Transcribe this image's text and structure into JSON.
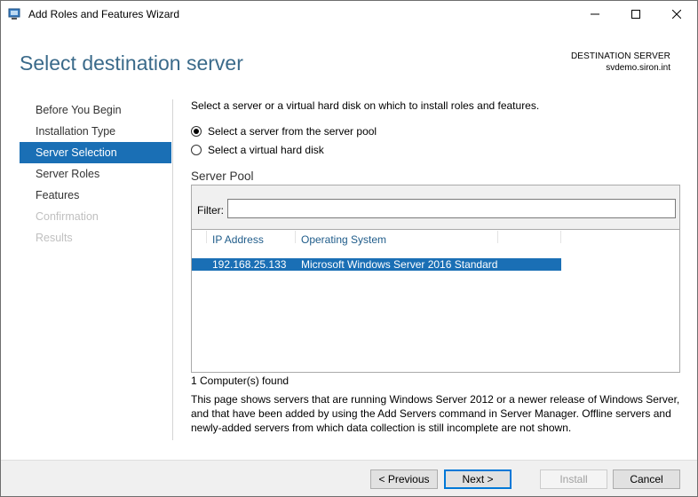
{
  "window": {
    "title": "Add Roles and Features Wizard"
  },
  "header": {
    "title": "Select destination server",
    "destination_label": "DESTINATION SERVER",
    "destination_value": "svdemo.siron.int"
  },
  "nav": {
    "items": [
      {
        "label": "Before You Begin",
        "state": "normal"
      },
      {
        "label": "Installation Type",
        "state": "normal"
      },
      {
        "label": "Server Selection",
        "state": "active"
      },
      {
        "label": "Server Roles",
        "state": "normal"
      },
      {
        "label": "Features",
        "state": "normal"
      },
      {
        "label": "Confirmation",
        "state": "disabled"
      },
      {
        "label": "Results",
        "state": "disabled"
      }
    ]
  },
  "main": {
    "instruction": "Select a server or a virtual hard disk on which to install roles and features.",
    "options": [
      {
        "label": "Select a server from the server pool",
        "selected": true
      },
      {
        "label": "Select a virtual hard disk",
        "selected": false
      }
    ],
    "pool": {
      "title": "Server Pool",
      "filter_label": "Filter:",
      "filter_value": "",
      "columns": [
        "IP Address",
        "Operating System"
      ],
      "rows": [
        {
          "ip": "192.168.25.133",
          "os": "Microsoft Windows Server 2016 Standard",
          "selected": true
        }
      ]
    },
    "found_text": "1 Computer(s) found",
    "description": "This page shows servers that are running Windows Server 2012 or a newer release of Windows Server, and that have been added by using the Add Servers command in Server Manager. Offline servers and newly-added servers from which data collection is still incomplete are not shown."
  },
  "footer": {
    "previous": "< Previous",
    "next": "Next >",
    "install": "Install",
    "cancel": "Cancel"
  },
  "colors": {
    "accent": "#1a6fb5",
    "header_title": "#3a6a8a",
    "disabled_text": "#c0c0c0"
  }
}
